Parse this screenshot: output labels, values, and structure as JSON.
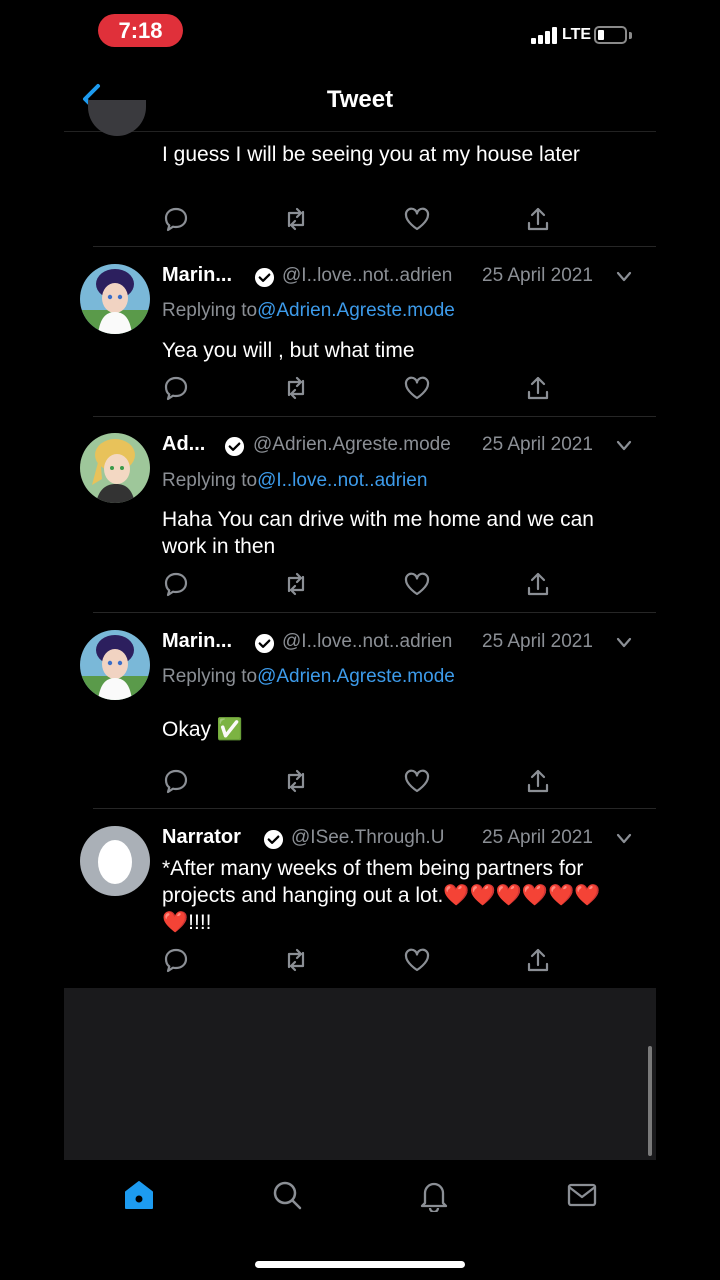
{
  "status_bar": {
    "time": "7:18",
    "network": "LTE",
    "battery_level": 0.15
  },
  "header": {
    "title": "Tweet"
  },
  "partial_tweet": {
    "text": "I guess I will be seeing you at my house later"
  },
  "tweets": [
    {
      "name": "Marin...",
      "handle": "@I..love..not..adrien",
      "date": "25 April 2021",
      "reply_label": "Replying to",
      "reply_to": "@Adrien.Agreste.mode",
      "text": "Yea you will , but what time"
    },
    {
      "name": "Ad...",
      "handle": "@Adrien.Agreste.mode",
      "date": "25 April 2021",
      "reply_label": "Replying to",
      "reply_to": "@I..love..not..adrien",
      "text": "Haha You can drive with me home and we can work in then"
    },
    {
      "name": "Marin...",
      "handle": "@I..love..not..adrien",
      "date": "25 April 2021",
      "reply_label": "Replying to",
      "reply_to": "@Adrien.Agreste.mode",
      "text": "Okay ✅"
    },
    {
      "name": "Narrator",
      "handle": "@ISee.Through.U",
      "date": "25 April 2021",
      "text": "*After many weeks of them being partners for projects and hanging out a lot.❤️❤️❤️❤️❤️❤️❤️!!!!"
    }
  ],
  "tabs": [
    "home-icon",
    "search-icon",
    "notifications-icon",
    "messages-icon"
  ],
  "colors": {
    "accent": "#1d9bf0",
    "mention": "#3d9bea",
    "time_pill": "#e0303a",
    "muted": "#8b8f95"
  }
}
